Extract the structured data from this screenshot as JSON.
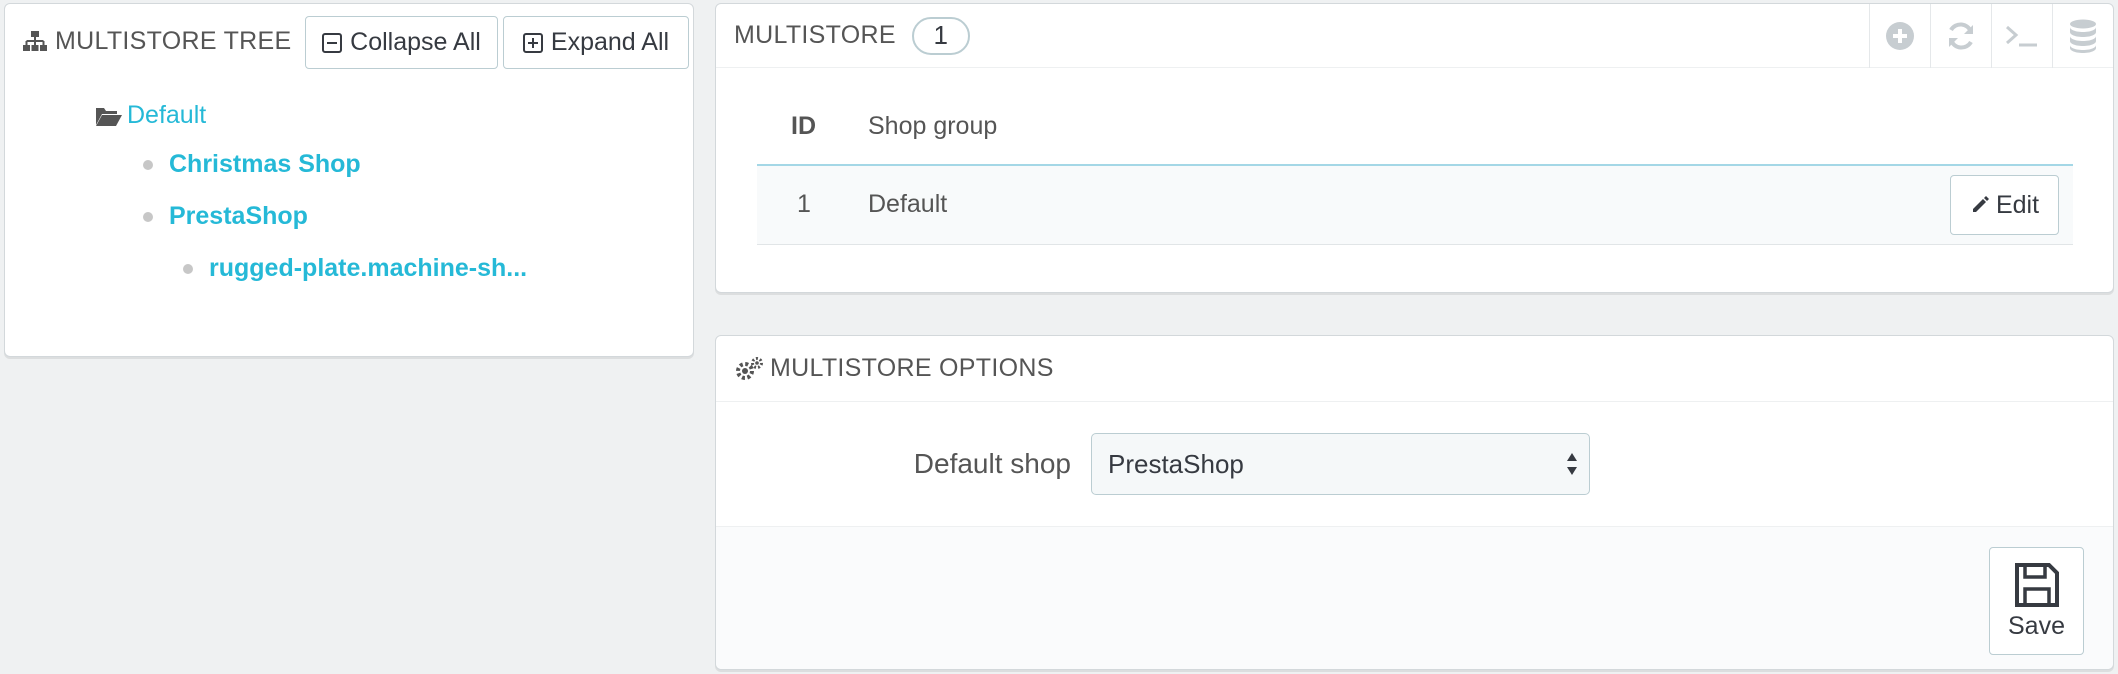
{
  "tree_panel": {
    "title": "Multistore tree",
    "collapse_label": "Collapse All",
    "expand_label": "Expand All",
    "nodes": [
      {
        "label": "Default"
      },
      {
        "label": "Christmas Shop"
      },
      {
        "label": "PrestaShop"
      },
      {
        "label": "rugged-plate.machine-sh..."
      }
    ]
  },
  "multistore_panel": {
    "title": "Multistore",
    "count": "1",
    "toolbar_icons": [
      "add-icon",
      "refresh-icon",
      "sql-query-icon",
      "database-export-icon"
    ],
    "columns": [
      "ID",
      "Shop group"
    ],
    "rows": [
      {
        "id": "1",
        "shop_group": "Default",
        "action": "Edit"
      }
    ]
  },
  "options_panel": {
    "title": "Multistore options",
    "default_shop_label": "Default shop",
    "default_shop_value": "PrestaShop",
    "save_label": "Save"
  },
  "colors": {
    "link": "#25b9d7",
    "background": "#eff1f2",
    "border": "#bbcdd2"
  }
}
